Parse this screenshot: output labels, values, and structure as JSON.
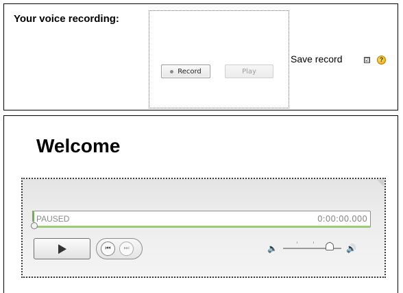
{
  "recorder": {
    "label": "Your voice recording:",
    "record_label": "Record",
    "play_label": "Play",
    "save_label": "Save record",
    "save_checked": true,
    "checkbox_mark": "☑",
    "help_icon": "?"
  },
  "player": {
    "title": "Welcome",
    "status": "PAUSED",
    "time": "0:00:00.000",
    "progress": 0,
    "volume": 0.8,
    "icons": {
      "play": "play-icon",
      "prev": "skip-back-icon",
      "next": "skip-forward-icon",
      "mute": "speaker-mute-icon",
      "volume_max": "speaker-loud-icon"
    },
    "colors": {
      "progress_accent": "#9acd73"
    }
  }
}
